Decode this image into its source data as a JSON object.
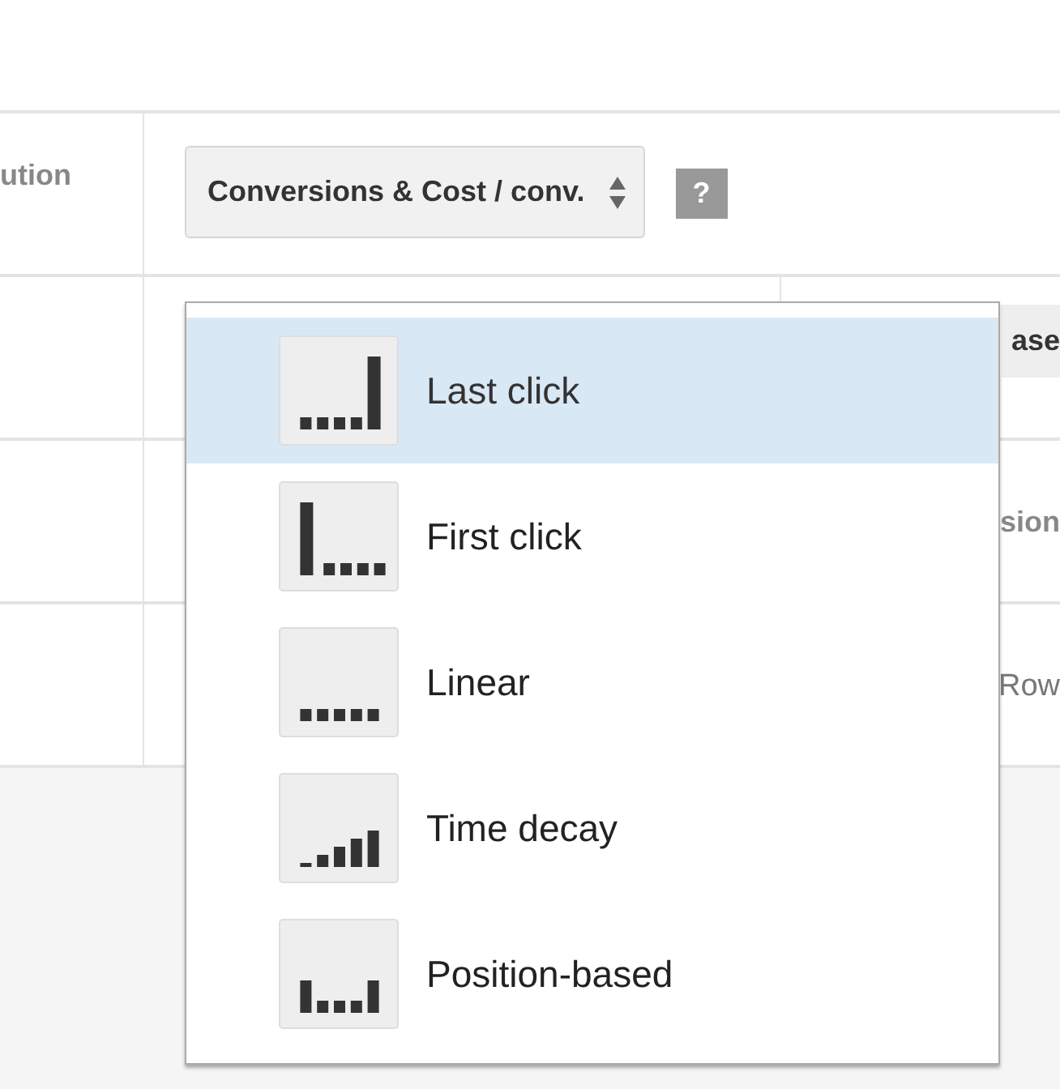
{
  "rows": [
    {
      "label": "ution",
      "select": {
        "value": "Conversions & Cost / conv."
      },
      "help": "?"
    },
    {
      "right": "ase",
      "kind": "button"
    },
    {
      "right": "sion",
      "kind": "text"
    },
    {
      "right": "Row",
      "kind": "muted"
    }
  ],
  "menu": {
    "items": [
      {
        "label": "Last click",
        "kind": "last",
        "selected": true
      },
      {
        "label": "First click",
        "kind": "first",
        "selected": false
      },
      {
        "label": "Linear",
        "kind": "linear",
        "selected": false
      },
      {
        "label": "Time decay",
        "kind": "time_decay",
        "selected": false
      },
      {
        "label": "Position-based",
        "kind": "position",
        "selected": false
      }
    ]
  }
}
